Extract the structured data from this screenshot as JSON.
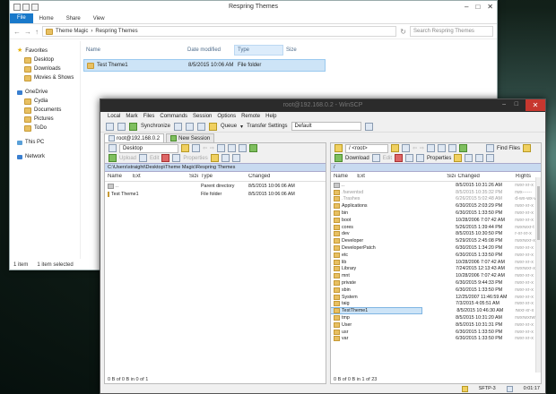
{
  "explorer": {
    "title": "Respring Themes",
    "ribbon_tabs": [
      "File",
      "Home",
      "Share",
      "View"
    ],
    "breadcrumb": [
      "Theme Magic",
      "Respring Themes"
    ],
    "search_placeholder": "Search Respring Themes",
    "sidebar": [
      {
        "label": "Favorites",
        "icon": "star-icon",
        "kind": "head"
      },
      {
        "label": "Desktop",
        "icon": "folder-icon",
        "kind": "sub"
      },
      {
        "label": "Downloads",
        "icon": "folder-icon",
        "kind": "sub"
      },
      {
        "label": "Movies & Shows",
        "icon": "folder-icon",
        "kind": "sub"
      },
      {
        "label": "OneDrive",
        "icon": "cloud-icon",
        "kind": "head-gap"
      },
      {
        "label": "Cydia",
        "icon": "folder-icon",
        "kind": "sub"
      },
      {
        "label": "Documents",
        "icon": "folder-icon",
        "kind": "sub"
      },
      {
        "label": "Pictures",
        "icon": "folder-icon",
        "kind": "sub"
      },
      {
        "label": "ToDo",
        "icon": "folder-icon",
        "kind": "sub"
      },
      {
        "label": "This PC",
        "icon": "computer-icon",
        "kind": "head-gap"
      },
      {
        "label": "Network",
        "icon": "network-icon",
        "kind": "head-gap"
      }
    ],
    "columns": [
      "Name",
      "Date modified",
      "Type",
      "Size"
    ],
    "rows": [
      {
        "name": "Test Theme1",
        "date": "8/5/2015 10:06 AM",
        "type": "File folder",
        "size": ""
      }
    ],
    "status_items": "1 item",
    "status_selected": "1 item selected"
  },
  "winscp": {
    "title": "root@192.168.0.2 - WinSCP",
    "menu": [
      "Local",
      "Mark",
      "Files",
      "Commands",
      "Session",
      "Options",
      "Remote",
      "Help"
    ],
    "toolbar": {
      "synchronize": "Synchronize",
      "queue": "Queue",
      "transfer_settings": "Transfer Settings",
      "transfer_value": "Default"
    },
    "tabs": [
      {
        "label": "root@192.168.0.2"
      },
      {
        "label": "New Session"
      }
    ],
    "left": {
      "drive": "Desktop",
      "upload": "Upload",
      "edit": "Edit",
      "properties": "Properties",
      "path": "C:\\Users\\straight\\Desktop\\Theme Magic\\Respring Themes",
      "columns": [
        "Name",
        "Ext",
        "Size",
        "Type",
        "Changed"
      ],
      "rows": [
        {
          "name": "..",
          "ext": "",
          "size": "",
          "type": "Parent directory",
          "changed": "8/5/2015 10:06:06 AM",
          "up": true
        },
        {
          "name": "Test Theme1",
          "ext": "",
          "size": "",
          "type": "File folder",
          "changed": "8/5/2015 10:06:06 AM",
          "up": false
        }
      ],
      "status": "0 B of 0 B in 0 of 1"
    },
    "right": {
      "drive": "/ <root>",
      "find_files": "Find Files",
      "download": "Download",
      "edit": "Edit",
      "properties": "Properties",
      "path": "/",
      "columns": [
        "Name",
        "Ext",
        "Size",
        "Changed",
        "Rights"
      ],
      "rows": [
        {
          "name": "..",
          "changed": "8/5/2015 10:31:26 AM",
          "rights": "rwxr-xr-x",
          "hidden": false
        },
        {
          "name": ".fseventsd",
          "changed": "8/5/2015 10:35:32 PM",
          "rights": "rwx------",
          "hidden": true
        },
        {
          "name": ".Trashes",
          "changed": "6/26/2015 5:02:48 AM",
          "rights": "d-wx-wx-wt",
          "hidden": true
        },
        {
          "name": "Applications",
          "changed": "6/30/2015 2:03:29 PM",
          "rights": "rwxr-xr-x",
          "hidden": false
        },
        {
          "name": "bin",
          "changed": "6/30/2015 1:33:50 PM",
          "rights": "rwxr-xr-x",
          "hidden": false
        },
        {
          "name": "boot",
          "changed": "10/28/2006 7:07:42 AM",
          "rights": "rwxr-xr-x",
          "hidden": false
        },
        {
          "name": "cores",
          "changed": "5/26/2015 1:39:44 PM",
          "rights": "rwxrwxr-t",
          "hidden": false
        },
        {
          "name": "dev",
          "changed": "8/5/2015 10:30:50 PM",
          "rights": "r-xr-xr-x",
          "hidden": false
        },
        {
          "name": "Developer",
          "changed": "5/29/2015 2:45:08 PM",
          "rights": "rwxrwxr-x",
          "hidden": false
        },
        {
          "name": "DeveloperPatch",
          "changed": "6/30/2015 1:34:20 PM",
          "rights": "rwxr-xr-x",
          "hidden": false
        },
        {
          "name": "etc",
          "changed": "6/30/2015 1:33:50 PM",
          "rights": "rwxr-xr-x",
          "hidden": false
        },
        {
          "name": "lib",
          "changed": "10/28/2006 7:07:42 AM",
          "rights": "rwxr-xr-x",
          "hidden": false
        },
        {
          "name": "Library",
          "changed": "7/24/2015 12:13:43 AM",
          "rights": "rwxrwxr-x",
          "hidden": false
        },
        {
          "name": "mnt",
          "changed": "10/28/2006 7:07:42 AM",
          "rights": "rwxr-xr-x",
          "hidden": false
        },
        {
          "name": "private",
          "changed": "6/30/2015 9:44:33 PM",
          "rights": "rwxr-xr-x",
          "hidden": false
        },
        {
          "name": "sbin",
          "changed": "6/30/2015 1:33:50 PM",
          "rights": "rwxr-xr-x",
          "hidden": false
        },
        {
          "name": "System",
          "changed": "12/25/2007 11:46:59 AM",
          "rights": "rwxr-xr-x",
          "hidden": false
        },
        {
          "name": "taig",
          "changed": "7/3/2015 4:05:51 AM",
          "rights": "rwxr-xr-x",
          "hidden": false
        },
        {
          "name": "TestTheme1",
          "changed": "8/5/2015 10:46:30 AM",
          "rights": "rwxr-xr-x",
          "hidden": false,
          "selected": true
        },
        {
          "name": "tmp",
          "changed": "8/5/2015 10:31:20 AM",
          "rights": "rwxrwxrwt",
          "hidden": false
        },
        {
          "name": "User",
          "changed": "8/5/2015 10:31:31 PM",
          "rights": "rwxr-xr-x",
          "hidden": false
        },
        {
          "name": "usr",
          "changed": "6/30/2015 1:33:50 PM",
          "rights": "rwxr-xr-x",
          "hidden": false
        },
        {
          "name": "var",
          "changed": "6/30/2015 1:33:50 PM",
          "rights": "rwxr-xr-x",
          "hidden": false
        }
      ],
      "status": "0 B of 0 B in 1 of 23"
    },
    "bottom": {
      "protocol": "SFTP-3",
      "time": "0:01:17"
    }
  }
}
